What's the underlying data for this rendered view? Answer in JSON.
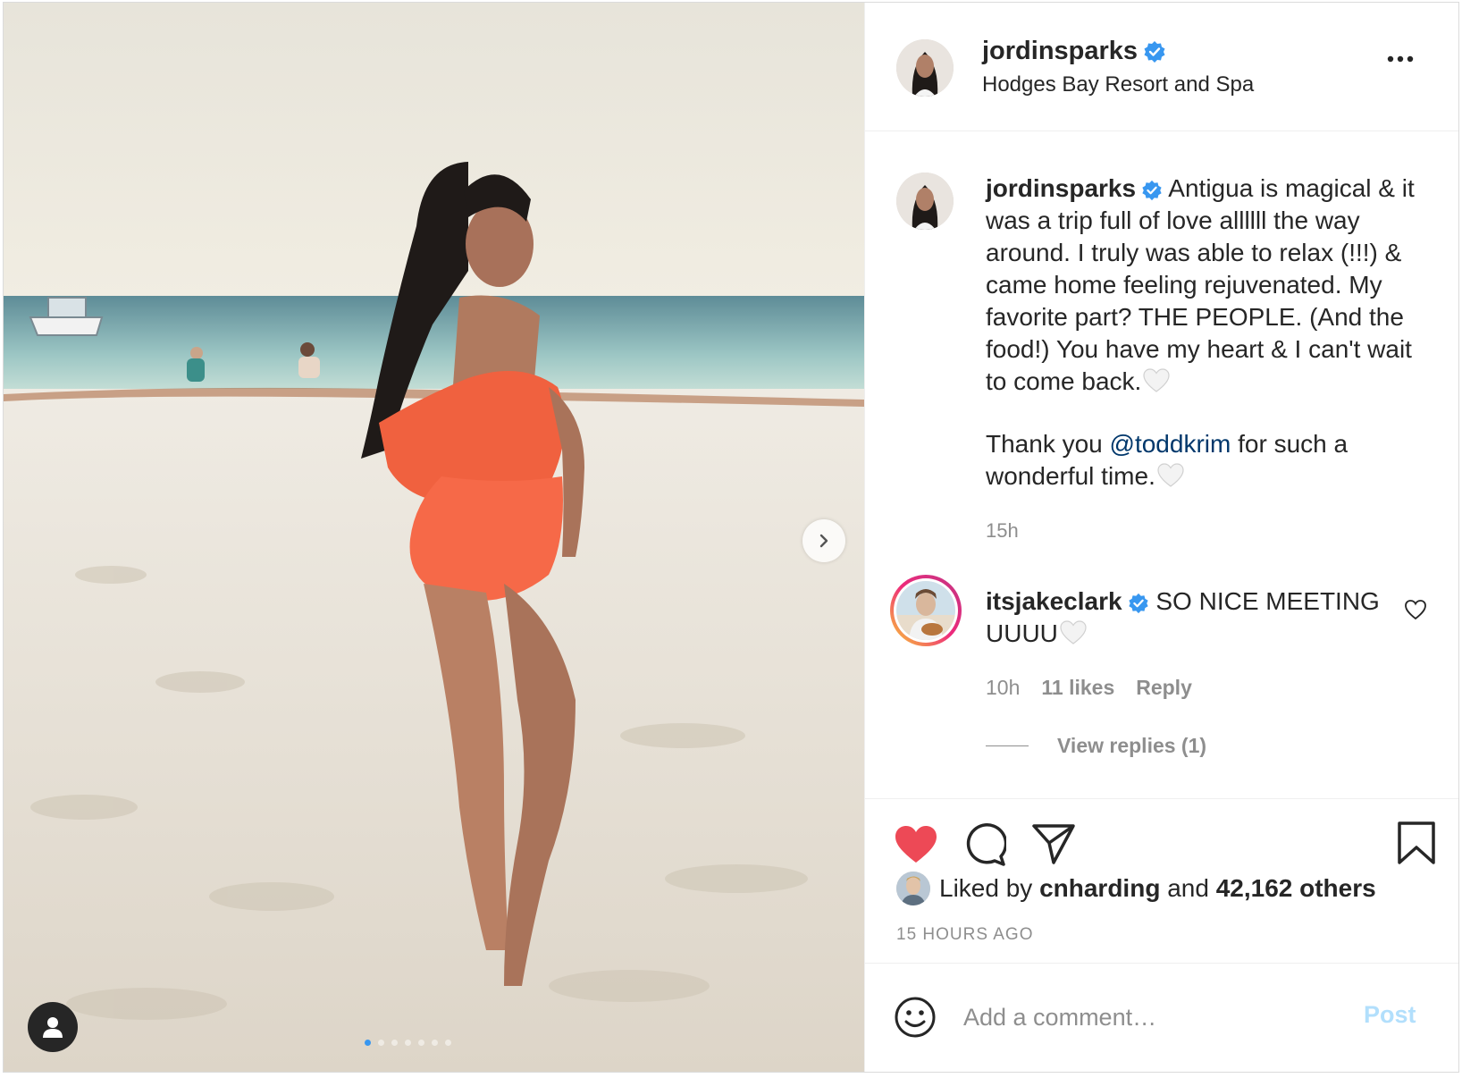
{
  "post": {
    "username": "jordinsparks",
    "location": "Hodges Bay Resort and Spa",
    "caption_text": "Antigua is magical & it was a trip full of love allllll the way around. I truly was able to relax (!!!) & came home feeling rejuvenated. My favorite part? THE PEOPLE. (And the food!) You have my heart & I can't wait to come back.",
    "thanks_before": "Thank you",
    "thanks_mention": "@toddkrim",
    "thanks_after": "for such a wonderful time.",
    "caption_time": "15h"
  },
  "comment": {
    "username": "itsjakeclark",
    "text": "SO NICE MEETING UUUU",
    "time": "10h",
    "likes": "11 likes",
    "reply_label": "Reply",
    "view_replies": "View replies (1)"
  },
  "likes": {
    "prefix": "Liked by",
    "user": "cnharding",
    "and": "and",
    "others": "42,162 others"
  },
  "timestamp": "15 HOURS AGO",
  "add_comment": {
    "placeholder": "Add a comment…",
    "post_label": "Post"
  },
  "carousel": {
    "slides": 7,
    "current": 1
  },
  "colors": {
    "like_red": "#ed4956",
    "link_blue": "#00376b",
    "verified_blue": "#3897f0",
    "post_disabled": "#b2dffc"
  },
  "icons": [
    "verified-icon",
    "more-options-icon",
    "chevron-right-icon",
    "user-tag-icon",
    "heart-icon",
    "comment-icon",
    "share-icon",
    "bookmark-icon",
    "emoji-icon",
    "white-heart-emoji"
  ]
}
